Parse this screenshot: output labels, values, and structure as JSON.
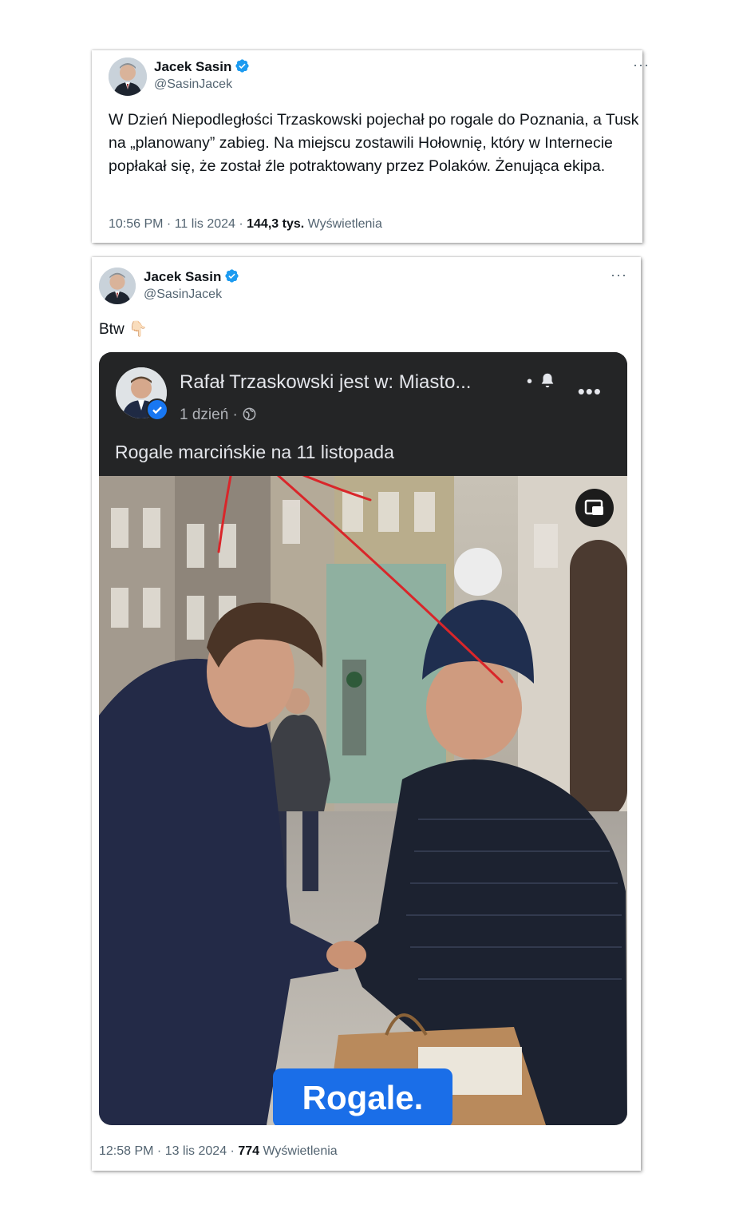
{
  "tweet1": {
    "author_name": "Jacek Sasin",
    "author_handle": "@SasinJacek",
    "more_label": "···",
    "text": "W Dzień Niepodległości Trzaskowski pojechał po rogale do Poznania, a Tusk na „planowany” zabieg. Na miejscu zostawili Hołownię, który w Internecie popłakał się, że został źle potraktowany przez Polaków. Żenująca ekipa.",
    "timestamp": "10:56 PM · 11 lis 2024 · ",
    "views_count": "144,3 tys.",
    "views_label": " Wyświetlenia"
  },
  "tweet2": {
    "author_name": "Jacek Sasin",
    "author_handle": "@SasinJacek",
    "more_label": "···",
    "text": "Btw 👇🏻",
    "timestamp": "12:58 PM · 13 lis 2024 · ",
    "views_count": "774",
    "views_label": " Wyświetlenia",
    "embedded_post": {
      "author": "Rafał Trzaskowski jest w: Miasto...",
      "time": "1 dzień · ",
      "globe_icon": "globe-icon",
      "bell_icon": "bell-icon",
      "menu_label": "•••",
      "separator": "•",
      "caption": "Rogale marcińskie na 11 listopada",
      "video_caption": "Rogale."
    }
  },
  "colors": {
    "verified_blue": "#1d9bf0",
    "muted_text": "#536471",
    "fb_dark": "#242526",
    "caption_blue": "#1a6ee8",
    "annotation_red": "#d9262a"
  }
}
